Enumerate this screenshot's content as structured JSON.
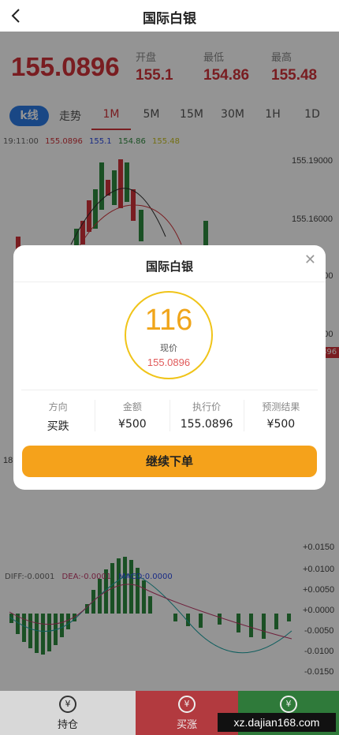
{
  "header": {
    "title": "国际白银"
  },
  "quote": {
    "last": "155.0896",
    "stats": [
      {
        "label": "开盘",
        "value": "155.1"
      },
      {
        "label": "最低",
        "value": "154.86"
      },
      {
        "label": "最高",
        "value": "155.48"
      }
    ]
  },
  "tabs": [
    "k线",
    "走势",
    "1M",
    "5M",
    "15M",
    "30M",
    "1H",
    "1D"
  ],
  "ma": {
    "time": "19:11:00",
    "a": "155.0896",
    "b": "155.1",
    "c": "154.86",
    "d": "155.48"
  },
  "price_axis": [
    "155.19000",
    "155.16000",
    "1000",
    "1000"
  ],
  "price_tag": "896",
  "left_stub": "18",
  "macd": {
    "diff": "DIFF:-0.0001",
    "dea": "DEA:-0.0001",
    "macd": "MACD:0.0000"
  },
  "macd_axis": [
    "+0.0150",
    "+0.0100",
    "+0.0050",
    "+0.0000",
    "-0.0050",
    "-0.0100",
    "-0.0150"
  ],
  "modal": {
    "title": "国际白银",
    "countdown": "116",
    "current_label": "现价",
    "current_value": "155.0896",
    "columns": [
      {
        "label": "方向",
        "value": "买跌"
      },
      {
        "label": "金额",
        "value": "¥500"
      },
      {
        "label": "执行价",
        "value": "155.0896"
      },
      {
        "label": "预测结果",
        "value": "¥500"
      }
    ],
    "button": "继续下单"
  },
  "bottom": {
    "hold": "持仓",
    "up": "买涨",
    "down": ""
  },
  "watermark": "xz.dajian168.com",
  "colors": {
    "red": "#d0323a",
    "green": "#2e8b3e",
    "blue": "#2c7be5",
    "orange": "#f5a21b"
  },
  "icons": {
    "back": "chevron-left-icon",
    "close": "close-icon",
    "coin": "coin-icon"
  }
}
